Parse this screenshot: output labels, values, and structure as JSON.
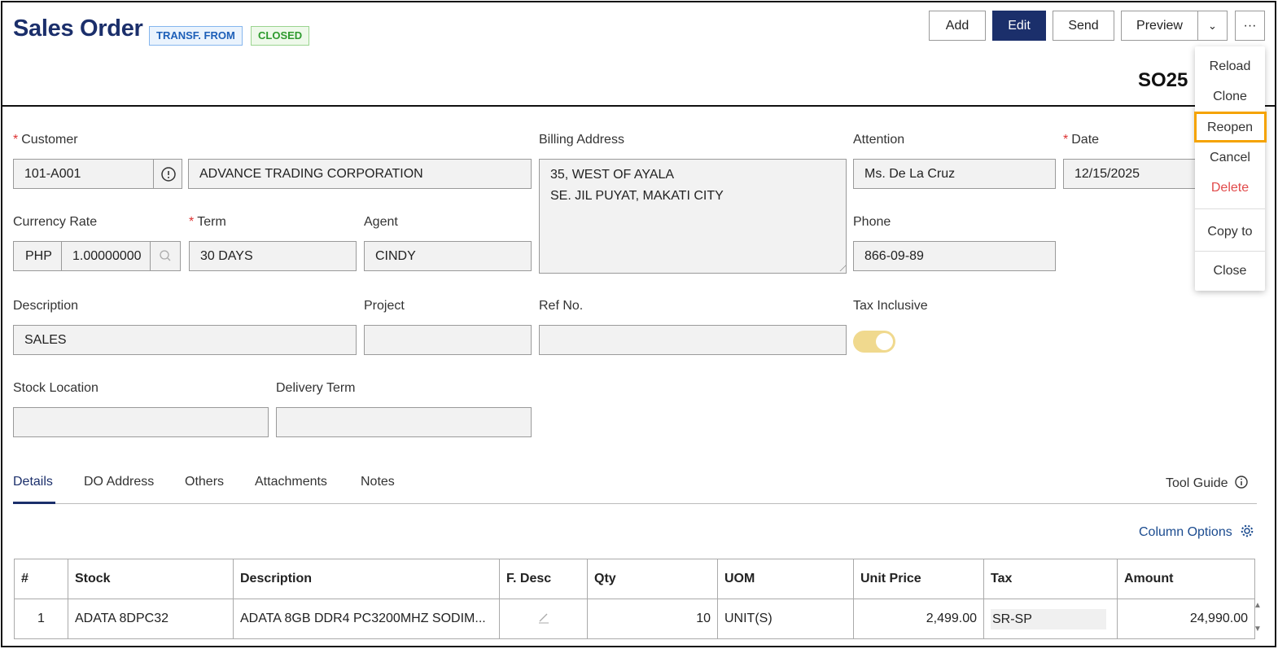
{
  "header": {
    "title": "Sales Order",
    "tags": [
      "TRANSF. FROM",
      "CLOSED"
    ],
    "doc_no": "SO25",
    "buttons": {
      "add": "Add",
      "edit": "Edit",
      "send": "Send",
      "preview": "Preview",
      "dropdown": "⌄",
      "more": "···"
    }
  },
  "menu": {
    "items": [
      "Reload",
      "Clone",
      "Reopen",
      "Cancel",
      "Delete",
      "Copy to",
      "Close"
    ],
    "highlighted": "Reopen"
  },
  "form": {
    "customer_label": "Customer",
    "customer_code": "101-A001",
    "customer_name": "ADVANCE TRADING CORPORATION",
    "billing_label": "Billing Address",
    "billing_line1": "35, WEST OF AYALA",
    "billing_line2": "SE. JIL PUYAT, MAKATI CITY",
    "attention_label": "Attention",
    "attention": "Ms. De La Cruz",
    "date_label": "Date",
    "date": "12/15/2025",
    "currency_label": "Currency Rate",
    "currency": "PHP",
    "rate": "1.00000000",
    "term_label": "Term",
    "term": "30 DAYS",
    "agent_label": "Agent",
    "agent": "CINDY",
    "phone_label": "Phone",
    "phone": "866-09-89",
    "description_label": "Description",
    "description": "SALES",
    "project_label": "Project",
    "project": "",
    "refno_label": "Ref No.",
    "refno": "",
    "tax_inclusive_label": "Tax Inclusive",
    "tax_inclusive": true,
    "stock_location_label": "Stock Location",
    "stock_location": "",
    "delivery_term_label": "Delivery Term",
    "delivery_term": ""
  },
  "tabs": [
    "Details",
    "DO Address",
    "Others",
    "Attachments",
    "Notes"
  ],
  "active_tab": "Details",
  "tool_guide": "Tool Guide",
  "column_options": "Column Options",
  "grid": {
    "columns": [
      "#",
      "Stock",
      "Description",
      "F. Desc",
      "Qty",
      "UOM",
      "Unit Price",
      "Tax",
      "Amount"
    ],
    "rows": [
      [
        "1",
        "ADATA 8DPC32",
        "ADATA 8GB DDR4 PC3200MHZ SODIM...",
        "",
        "10",
        "UNIT(S)",
        "2,499.00",
        "SR-SP",
        "24,990.00"
      ]
    ]
  },
  "colors": {
    "brand": "#1b2f6b",
    "highlight": "#f5a300",
    "danger": "#e14a4a"
  }
}
